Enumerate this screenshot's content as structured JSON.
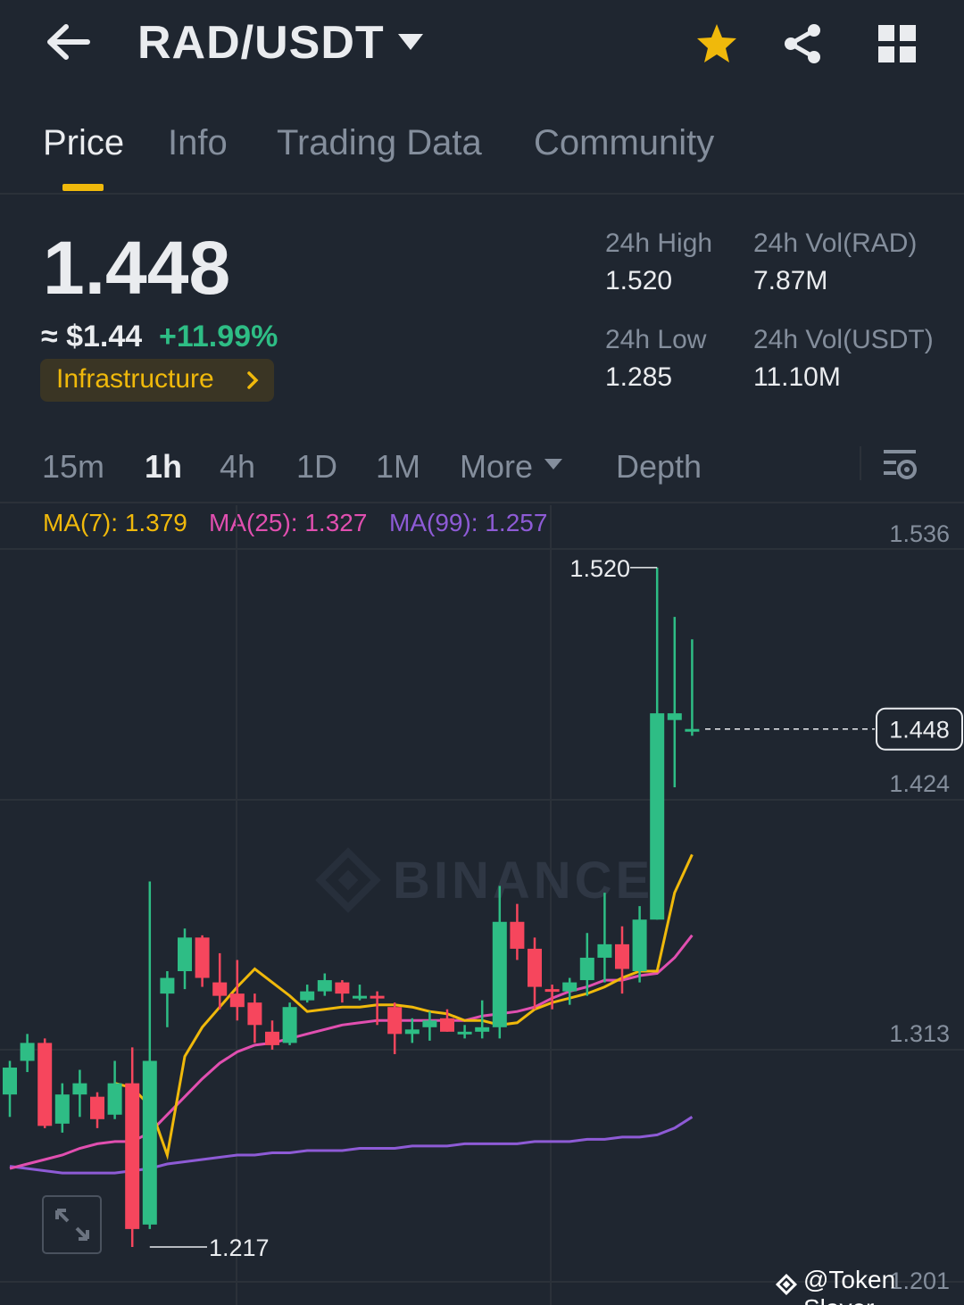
{
  "header": {
    "pair": "RAD/USDT"
  },
  "tabs": [
    {
      "label": "Price",
      "active": true
    },
    {
      "label": "Info",
      "active": false
    },
    {
      "label": "Trading Data",
      "active": false
    },
    {
      "label": "Community",
      "active": false
    }
  ],
  "ticker": {
    "last_price": "1.448",
    "approx_usd": "≈ $1.44",
    "change_pct": "+11.99%",
    "category": "Infrastructure",
    "stats": {
      "high_label": "24h High",
      "high": "1.520",
      "low_label": "24h Low",
      "low": "1.285",
      "vol_base_label": "24h Vol(RAD)",
      "vol_base": "7.87M",
      "vol_quote_label": "24h Vol(USDT)",
      "vol_quote": "11.10M"
    }
  },
  "intervals": {
    "items": [
      "15m",
      "1h",
      "4h",
      "1D",
      "1M"
    ],
    "active": "1h",
    "more": "More",
    "depth": "Depth"
  },
  "ma": {
    "ma7": "MA(7): 1.379",
    "ma25": "MA(25): 1.327",
    "ma99": "MA(99): 1.257"
  },
  "colors": {
    "up": "#2ebd85",
    "down": "#f6465d",
    "ma7": "#f0b90b",
    "ma25": "#e14fb0",
    "ma99": "#8e5bd6",
    "accent": "#f0b90b"
  },
  "chart_data": {
    "type": "candlestick",
    "axis_labels": [
      "1.536",
      "1.424",
      "1.313",
      "1.201"
    ],
    "current_price_label": "1.448",
    "high_marker": "1.520",
    "low_marker": "1.217",
    "watermark": "BINANCE",
    "candles": [
      {
        "o": 1.285,
        "h": 1.3,
        "l": 1.275,
        "c": 1.297
      },
      {
        "o": 1.3,
        "h": 1.312,
        "l": 1.295,
        "c": 1.308
      },
      {
        "o": 1.308,
        "h": 1.31,
        "l": 1.27,
        "c": 1.271
      },
      {
        "o": 1.272,
        "h": 1.29,
        "l": 1.268,
        "c": 1.285
      },
      {
        "o": 1.285,
        "h": 1.296,
        "l": 1.275,
        "c": 1.29
      },
      {
        "o": 1.284,
        "h": 1.286,
        "l": 1.27,
        "c": 1.274
      },
      {
        "o": 1.276,
        "h": 1.3,
        "l": 1.274,
        "c": 1.29
      },
      {
        "o": 1.29,
        "h": 1.306,
        "l": 1.217,
        "c": 1.225
      },
      {
        "o": 1.227,
        "h": 1.38,
        "l": 1.225,
        "c": 1.3
      },
      {
        "o": 1.33,
        "h": 1.34,
        "l": 1.315,
        "c": 1.337
      },
      {
        "o": 1.34,
        "h": 1.359,
        "l": 1.332,
        "c": 1.355
      },
      {
        "o": 1.355,
        "h": 1.356,
        "l": 1.333,
        "c": 1.337
      },
      {
        "o": 1.335,
        "h": 1.348,
        "l": 1.323,
        "c": 1.329
      },
      {
        "o": 1.33,
        "h": 1.345,
        "l": 1.318,
        "c": 1.324
      },
      {
        "o": 1.326,
        "h": 1.33,
        "l": 1.308,
        "c": 1.316
      },
      {
        "o": 1.313,
        "h": 1.318,
        "l": 1.305,
        "c": 1.307
      },
      {
        "o": 1.308,
        "h": 1.326,
        "l": 1.307,
        "c": 1.324
      },
      {
        "o": 1.327,
        "h": 1.334,
        "l": 1.326,
        "c": 1.331
      },
      {
        "o": 1.331,
        "h": 1.339,
        "l": 1.329,
        "c": 1.336
      },
      {
        "o": 1.335,
        "h": 1.336,
        "l": 1.326,
        "c": 1.33
      },
      {
        "o": 1.328,
        "h": 1.334,
        "l": 1.327,
        "c": 1.329
      },
      {
        "o": 1.329,
        "h": 1.331,
        "l": 1.316,
        "c": 1.328
      },
      {
        "o": 1.324,
        "h": 1.326,
        "l": 1.303,
        "c": 1.312
      },
      {
        "o": 1.312,
        "h": 1.319,
        "l": 1.308,
        "c": 1.314
      },
      {
        "o": 1.315,
        "h": 1.322,
        "l": 1.309,
        "c": 1.318
      },
      {
        "o": 1.319,
        "h": 1.323,
        "l": 1.313,
        "c": 1.313
      },
      {
        "o": 1.313,
        "h": 1.316,
        "l": 1.31,
        "c": 1.313
      },
      {
        "o": 1.313,
        "h": 1.327,
        "l": 1.31,
        "c": 1.315
      },
      {
        "o": 1.315,
        "h": 1.378,
        "l": 1.31,
        "c": 1.362
      },
      {
        "o": 1.362,
        "h": 1.37,
        "l": 1.345,
        "c": 1.35
      },
      {
        "o": 1.35,
        "h": 1.355,
        "l": 1.323,
        "c": 1.333
      },
      {
        "o": 1.332,
        "h": 1.334,
        "l": 1.323,
        "c": 1.331
      },
      {
        "o": 1.331,
        "h": 1.337,
        "l": 1.325,
        "c": 1.335
      },
      {
        "o": 1.336,
        "h": 1.357,
        "l": 1.329,
        "c": 1.346
      },
      {
        "o": 1.346,
        "h": 1.375,
        "l": 1.335,
        "c": 1.352
      },
      {
        "o": 1.352,
        "h": 1.36,
        "l": 1.33,
        "c": 1.341
      },
      {
        "o": 1.34,
        "h": 1.369,
        "l": 1.335,
        "c": 1.363
      },
      {
        "o": 1.363,
        "h": 1.52,
        "l": 1.363,
        "c": 1.455
      },
      {
        "o": 1.452,
        "h": 1.498,
        "l": 1.422,
        "c": 1.455
      },
      {
        "o": 1.447,
        "h": 1.488,
        "l": 1.445,
        "c": 1.448
      }
    ],
    "ma7": [
      null,
      null,
      null,
      null,
      null,
      null,
      1.29,
      1.288,
      1.28,
      1.258,
      1.302,
      1.315,
      1.324,
      1.333,
      1.341,
      1.335,
      1.329,
      1.322,
      1.323,
      1.324,
      1.324,
      1.325,
      1.325,
      1.324,
      1.322,
      1.321,
      1.318,
      1.318,
      1.316,
      1.317,
      1.323,
      1.326,
      1.328,
      1.33,
      1.333,
      1.337,
      1.34,
      1.34,
      1.375,
      1.392
    ],
    "ma25": [
      1.252,
      1.254,
      1.256,
      1.258,
      1.261,
      1.263,
      1.264,
      1.264,
      1.268,
      1.276,
      1.284,
      1.292,
      1.299,
      1.304,
      1.307,
      1.308,
      1.31,
      1.312,
      1.314,
      1.316,
      1.317,
      1.318,
      1.318,
      1.318,
      1.318,
      1.318,
      1.318,
      1.32,
      1.321,
      1.322,
      1.324,
      1.328,
      1.331,
      1.333,
      1.336,
      1.336,
      1.338,
      1.339,
      1.346,
      1.356
    ],
    "ma99": [
      1.253,
      1.252,
      1.251,
      1.25,
      1.25,
      1.25,
      1.25,
      1.251,
      1.252,
      1.254,
      1.255,
      1.256,
      1.257,
      1.258,
      1.258,
      1.259,
      1.259,
      1.26,
      1.26,
      1.26,
      1.261,
      1.261,
      1.261,
      1.262,
      1.262,
      1.262,
      1.263,
      1.263,
      1.263,
      1.263,
      1.264,
      1.264,
      1.264,
      1.265,
      1.265,
      1.266,
      1.266,
      1.267,
      1.27,
      1.275
    ]
  },
  "watermark_text": "@Token Slayer"
}
